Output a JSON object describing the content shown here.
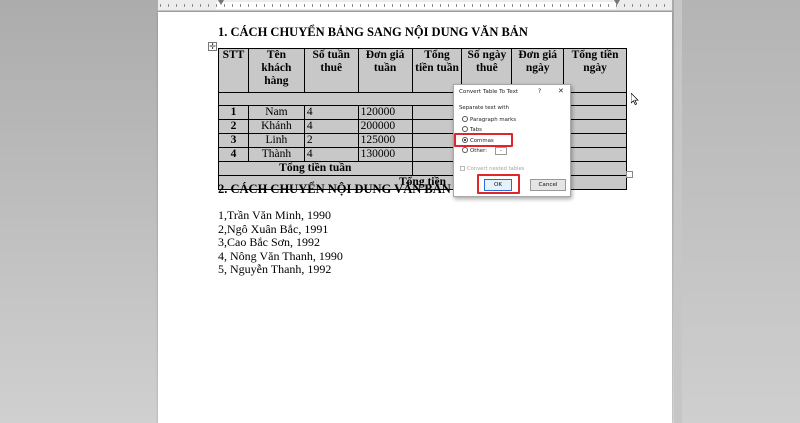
{
  "document": {
    "heading1": "1. CÁCH CHUYỂN BẢNG SANG NỘI DUNG VĂN BẢN",
    "heading2": "2. CÁCH CHUYỂN NỘI DUNG VĂN BẢN SAN",
    "table": {
      "headers": [
        "STT",
        "Tên khách hàng",
        "Số tuần thuê",
        "Đơn giá tuần",
        "Tổng tiền tuần",
        "Số ngày thuê",
        "Đơn giá ngày",
        "Tổng tiền ngày"
      ],
      "rows": [
        [
          "1",
          "Nam",
          "4",
          "120000"
        ],
        [
          "2",
          "Khánh",
          "4",
          "200000"
        ],
        [
          "3",
          "Linh",
          "2",
          "125000"
        ],
        [
          "4",
          "Thành",
          "4",
          "130000"
        ]
      ],
      "total_week_label": "Tổng tiền tuần",
      "total_label": "Tổng tiền"
    },
    "list": [
      "1,Trần Văn Minh, 1990",
      "2,Ngô Xuân Bắc, 1991",
      "3,Cao Bắc Sơn, 1992",
      "4, Nông Văn Thanh, 1990",
      "5, Nguyễn Thanh, 1992"
    ]
  },
  "dialog": {
    "title": "Convert Table To Text",
    "help": "?",
    "close": "✕",
    "separate_label": "Separate text with",
    "options": [
      "Paragraph marks",
      "Tabs",
      "Commas",
      "Other:"
    ],
    "selected": "Commas",
    "other_value": "-",
    "nested_label": "Convert nested tables",
    "ok": "OK",
    "cancel": "Cancel"
  },
  "colors": {
    "highlight": "#e0252c",
    "table_shade": "#c8c8c8",
    "ok_border": "#2a6fd6"
  }
}
